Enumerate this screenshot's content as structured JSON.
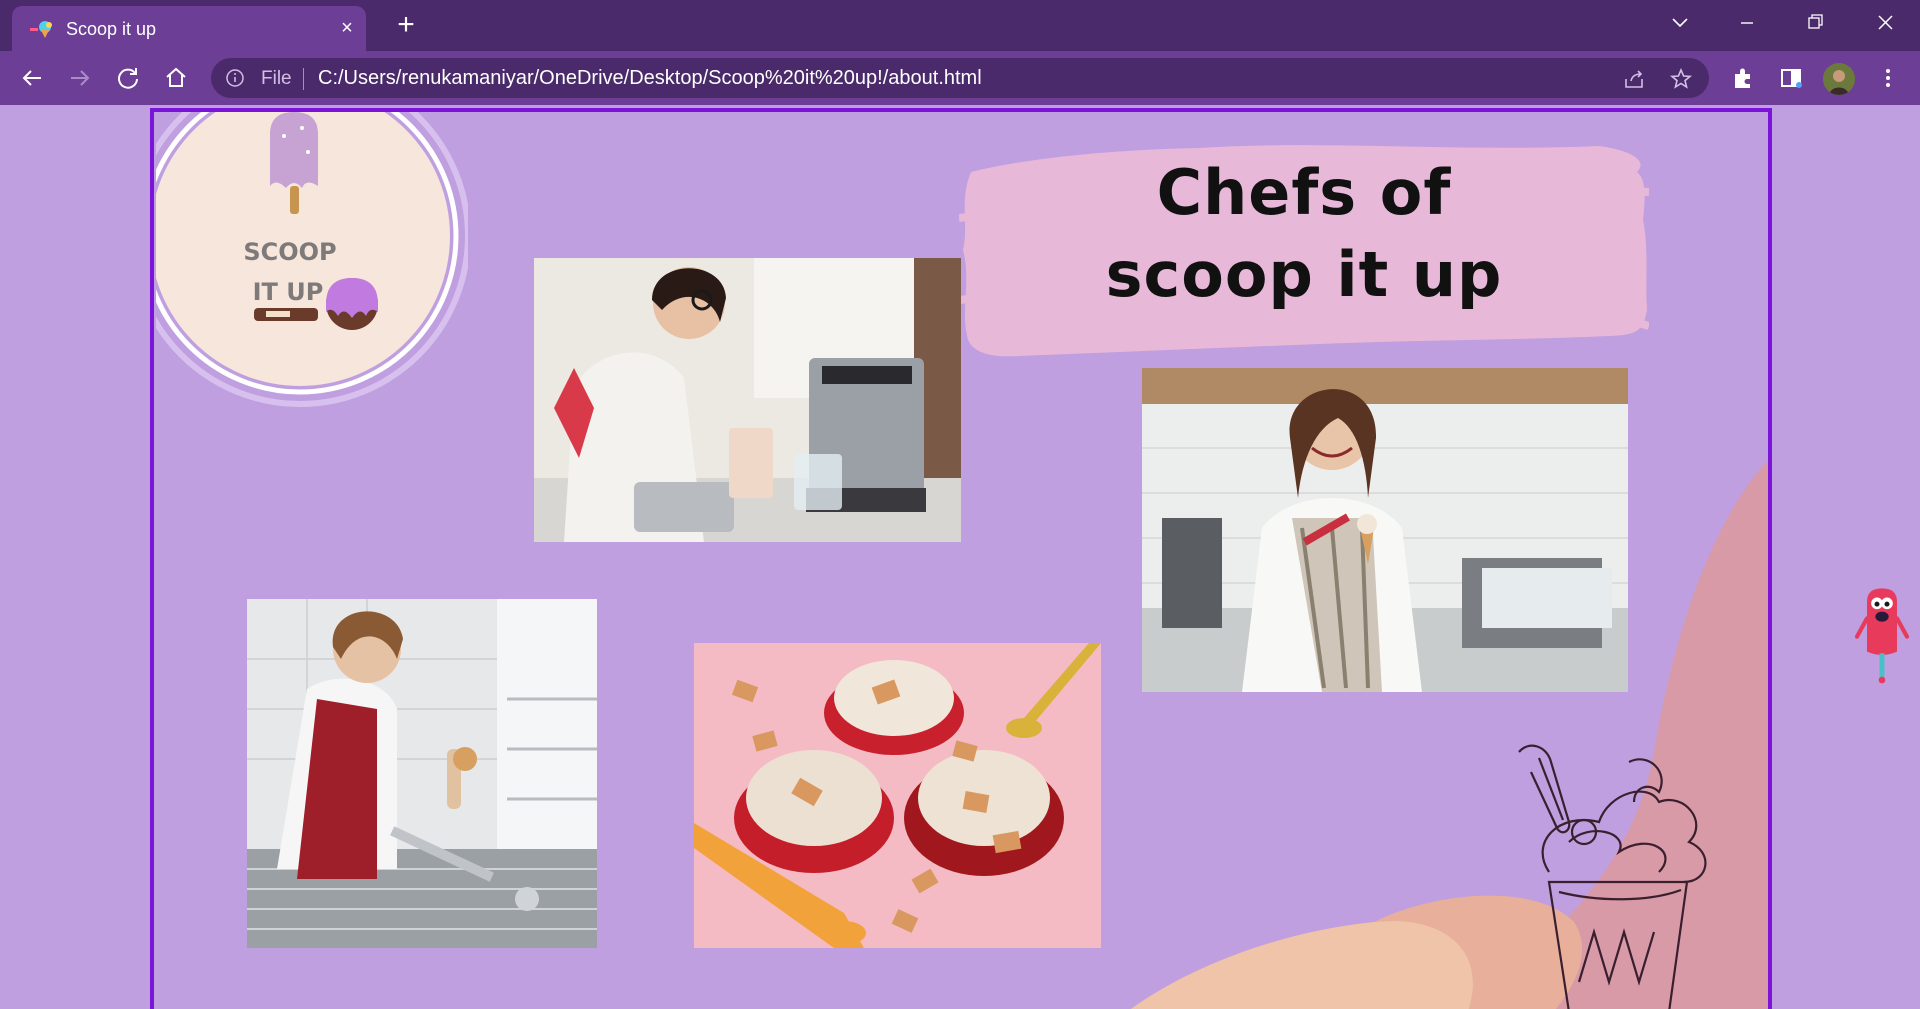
{
  "browser": {
    "tab_title": "Scoop it up",
    "tab_close": "×",
    "new_tab": "+",
    "scheme_label": "File",
    "url": "C:/Users/renukamaniyar/OneDrive/Desktop/Scoop%20it%20up!/about.html"
  },
  "page": {
    "logo": {
      "line1": "SCOOP",
      "line2": "IT UP"
    },
    "headline": {
      "line1": "Chefs of",
      "line2": "scoop it up"
    },
    "photos": [
      {
        "name": "chef-making-ice-cream-photo"
      },
      {
        "name": "chef-scooping-cone-photo"
      },
      {
        "name": "chef-serving-ice-cream-photo"
      },
      {
        "name": "ice-cream-bowls-photo"
      }
    ]
  },
  "colors": {
    "accent_purple": "#7b13d8",
    "page_bg": "#bf9fdf",
    "headline_brush": "#e8b8d8",
    "tab_bg": "#6c3e96",
    "titlebar_bg": "#4a2a6a"
  }
}
